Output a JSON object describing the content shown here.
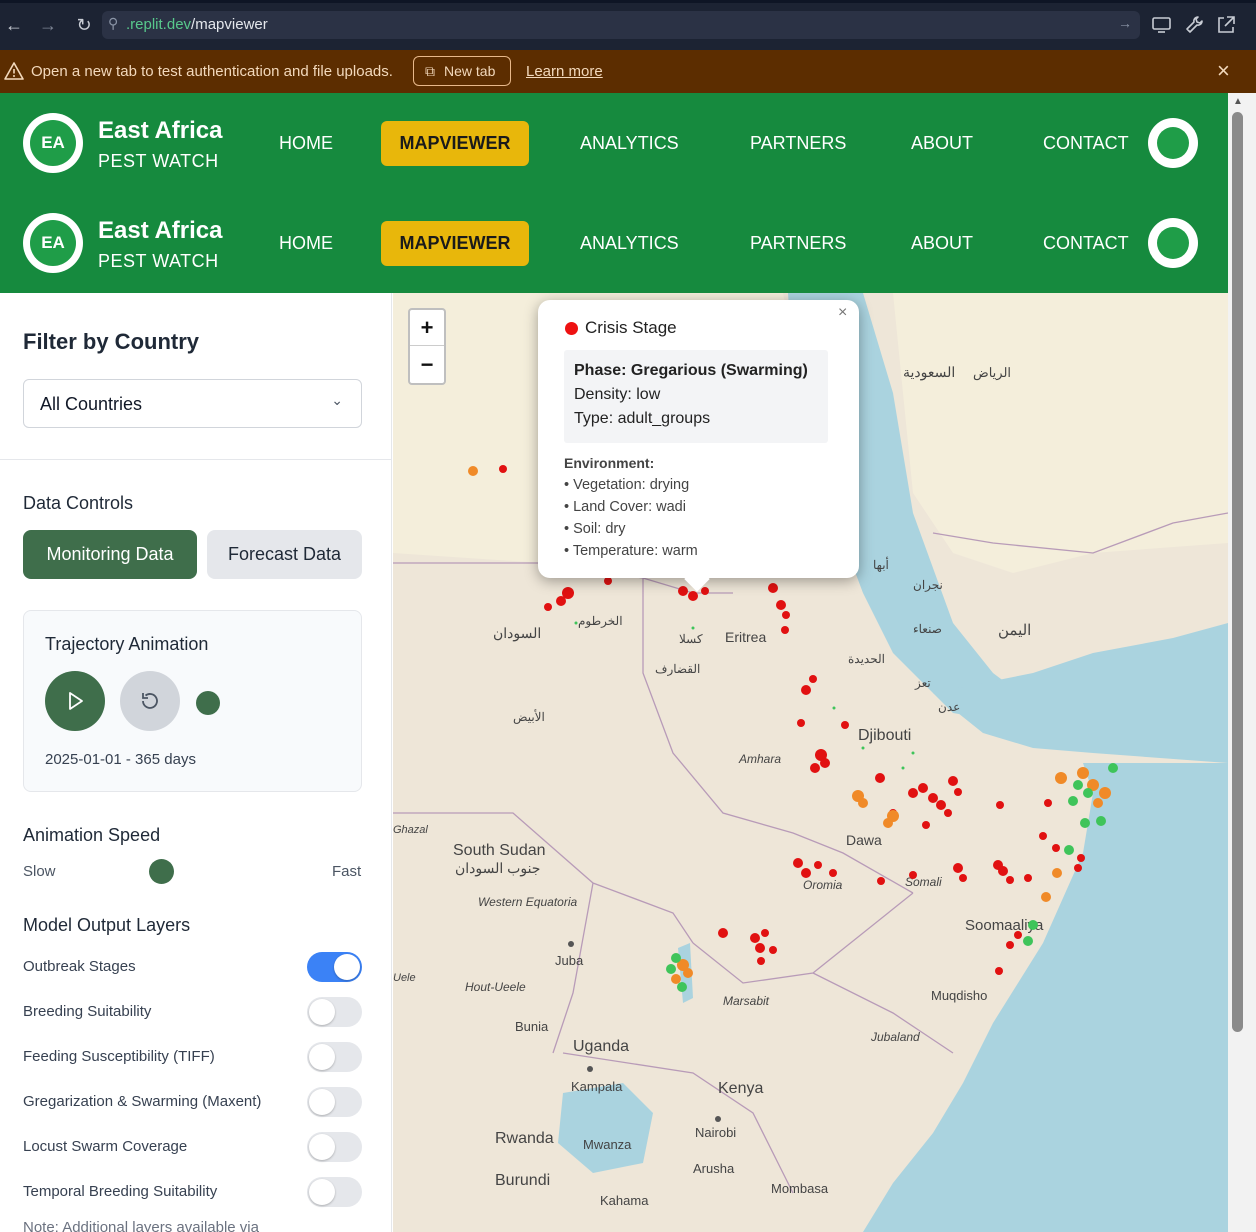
{
  "browser": {
    "url_domain": ".replit.dev",
    "url_path": "/mapviewer"
  },
  "banner": {
    "message": "Open a new tab to test authentication and file uploads.",
    "new_tab_label": "New tab",
    "learn_more_label": "Learn more"
  },
  "header": {
    "logo_text": "EA",
    "brand_title": "East Africa",
    "brand_subtitle": "PEST WATCH",
    "nav": {
      "home": "HOME",
      "mapviewer": "MAPVIEWER",
      "analytics": "ANALYTICS",
      "partners": "PARTNERS",
      "about": "ABOUT",
      "contact": "CONTACT"
    },
    "active_item": "MAPVIEWER"
  },
  "sidebar": {
    "filter_title": "Filter by Country",
    "country_select_value": "All Countries",
    "data_controls_label": "Data Controls",
    "monitoring_button": "Monitoring Data",
    "forecast_button": "Forecast Data",
    "trajectory_title": "Trajectory Animation",
    "trajectory_range": "2025-01-01 - 365 days",
    "speed_label": "Animation Speed",
    "speed_slow": "Slow",
    "speed_fast": "Fast",
    "speed_value": 0.4,
    "layers_title": "Model Output Layers",
    "layers": [
      {
        "label": "Outbreak Stages",
        "on": true
      },
      {
        "label": "Breeding Suitability",
        "on": false
      },
      {
        "label": "Feeding Susceptibility (TIFF)",
        "on": false
      },
      {
        "label": "Gregarization & Swarming (Maxent)",
        "on": false
      },
      {
        "label": "Locust Swarm Coverage",
        "on": false
      },
      {
        "label": "Temporal Breeding Suitability",
        "on": false
      }
    ],
    "note": "Note: Additional layers available via"
  },
  "map": {
    "zoom_in": "+",
    "zoom_out": "−",
    "labels": [
      "Djibouti",
      "Eritrea",
      "South Sudan",
      "Uganda",
      "Kenya",
      "Kampala",
      "Nairobi",
      "Juba",
      "Mombasa",
      "Muqdisho",
      "Rwanda",
      "Burundi",
      "Arusha",
      "Mwanza",
      "Kahama",
      "Bunia",
      "Marsabit",
      "Dawa",
      "Amhara",
      "Oromia",
      "Somali",
      "Soomaaliya",
      "Western Equatoria",
      "Hout-Ueele",
      "Jubaland",
      "Ghazal",
      "Uele",
      "Haut-Uele"
    ],
    "arabic_labels": [
      "السودان",
      "السعودية",
      "الرياض",
      "اليمن",
      "صنعاء",
      "الخرطوم",
      "كسلا",
      "القضارف",
      "الأبيض",
      "عدن",
      "جنوب السودان",
      "الحديدة",
      "نجران",
      "أبها",
      "تعز"
    ],
    "popup": {
      "title": "Crisis Stage",
      "status_color": "#e11111",
      "phase": "Phase: Gregarious (Swarming)",
      "density": "Density: low",
      "type": "Type: adult_groups",
      "env_heading": "Environment:",
      "env_items": [
        "• Vegetation: drying",
        "• Land Cover: wadi",
        "• Soil: dry",
        "• Temperature: warm"
      ],
      "close": "×"
    },
    "colors": {
      "land": "#eee6d8",
      "sea": "#aad3df",
      "crisis_marker": "#e11111",
      "outbreak_marker": "#f08a28",
      "recession_marker": "#3fc45a"
    }
  },
  "colors": {
    "header_green": "#168a3e",
    "accent_yellow": "#e8b70b",
    "button_green": "#3f6e4b",
    "toggle_blue": "#3b82f6",
    "banner_brown": "#5c2d00"
  }
}
